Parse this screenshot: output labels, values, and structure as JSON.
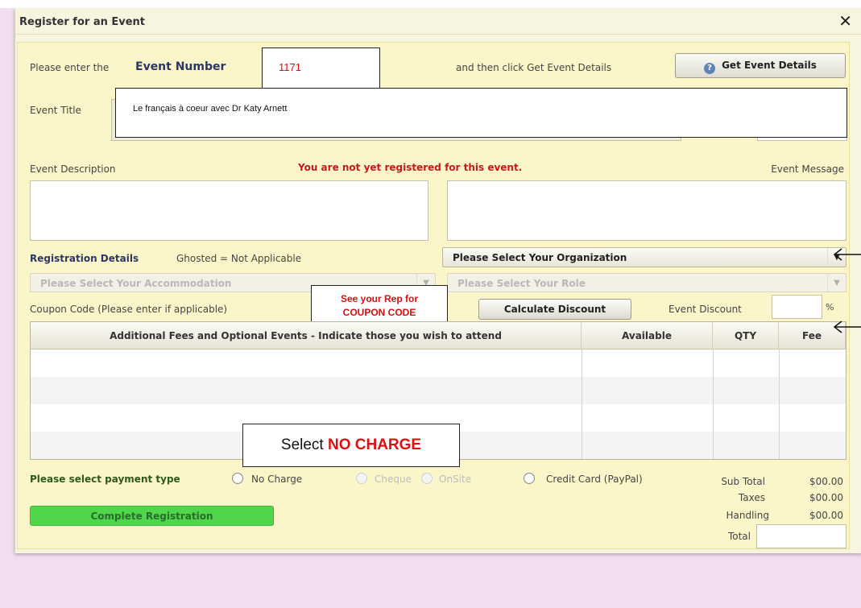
{
  "dialog": {
    "title": "Register for an Event",
    "close_symbol": "✕"
  },
  "event_number": {
    "prompt": "Please enter the",
    "label": "Event Number",
    "value": "1171",
    "after_text": "and then click Get Event Details",
    "button_label": "Get Event Details"
  },
  "event_title": {
    "label": "Event Title",
    "value": "Le français à coeur avec Dr Katy Arnett"
  },
  "description": {
    "label": "Event Description",
    "status_warning": "You are not yet registered for this event.",
    "message_label": "Event Message"
  },
  "registration": {
    "label": "Registration Details",
    "ghost_note": "Ghosted = Not Applicable",
    "organization_select": "Please Select Your Organization",
    "accommodation_select": "Please Select Your Accommodation",
    "role_select": "Please Select Your Role"
  },
  "coupon": {
    "label": "Coupon Code (Please enter if applicable)",
    "callout_line1": "See your Rep for",
    "callout_line2": "COUPON CODE",
    "calc_button": "Calculate Discount",
    "discount_label": "Event Discount",
    "percent_symbol": "%"
  },
  "fees_table": {
    "headers": [
      "Additional Fees and Optional Events - Indicate those you wish to attend",
      "Available",
      "QTY",
      "Fee"
    ]
  },
  "charge_callout": {
    "prefix": "Select ",
    "highlight": "NO CHARGE"
  },
  "payment": {
    "label": "Please select payment type",
    "options": [
      "No Charge",
      "Cheque",
      "OnSite",
      "Credit Card (PayPal)"
    ]
  },
  "summary": {
    "sub_total_label": "Sub Total",
    "sub_total": "$00.00",
    "taxes_label": "Taxes",
    "taxes": "$00.00",
    "handling_label": "Handling",
    "handling": "$00.00",
    "total_label": "Total"
  },
  "complete_button": "Complete Registration",
  "colors": {
    "warning_red": "#c21d1d",
    "complete_green": "#4fd64a",
    "panel_yellow": "#fbf6c9"
  }
}
